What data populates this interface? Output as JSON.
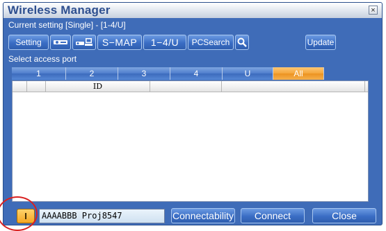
{
  "window": {
    "title": "Wireless Manager",
    "close_glyph": "×"
  },
  "status": {
    "current_setting": "Current setting  [Single] - [1-4/U]"
  },
  "toolbar": {
    "setting": "Setting",
    "smap": "S−MAP",
    "range": "1−4/U",
    "pcsearch": "PCSearch",
    "update": "Update"
  },
  "ports": {
    "label": "Select access port",
    "tabs": [
      "1",
      "2",
      "3",
      "4",
      "U",
      "All"
    ],
    "active": "All"
  },
  "list": {
    "columns": [
      "",
      "",
      "ID",
      "",
      "",
      ""
    ],
    "rows": []
  },
  "bottom": {
    "id_button": "I",
    "id_value": "AAAABBB Proj8547",
    "connectability": "Connectability",
    "connect": "Connect",
    "close": "Close"
  },
  "colors": {
    "window_bg": "#3f6cb8",
    "active_tab": "#f4a53a",
    "highlight_ring": "#d92020"
  },
  "icons": [
    "close-icon",
    "projector-icon",
    "projector-pc-icon",
    "magnifier-icon"
  ]
}
